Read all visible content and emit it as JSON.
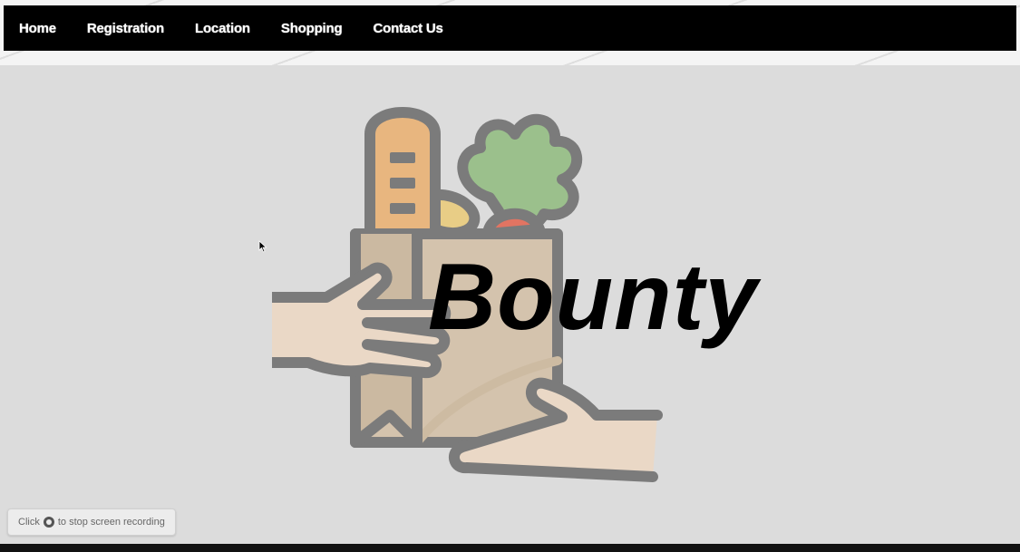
{
  "nav": {
    "items": [
      {
        "label": "Home"
      },
      {
        "label": "Registration"
      },
      {
        "label": "Location"
      },
      {
        "label": "Shopping"
      },
      {
        "label": "Contact Us"
      }
    ]
  },
  "hero": {
    "brand_text": "Bounty",
    "logo_icon": "grocery-bag-handoff-icon"
  },
  "recording_toast": {
    "prefix": "Click",
    "icon": "stop-recording-icon",
    "suffix": "to stop screen recording"
  },
  "colors": {
    "nav_background": "#000000",
    "page_background": "#dcdcdc",
    "bread": "#e8b67f",
    "greens": "#9bc08c",
    "bag": "#d4c3ad",
    "hands": "#ead8c6",
    "outline": "#7b7b7b"
  }
}
